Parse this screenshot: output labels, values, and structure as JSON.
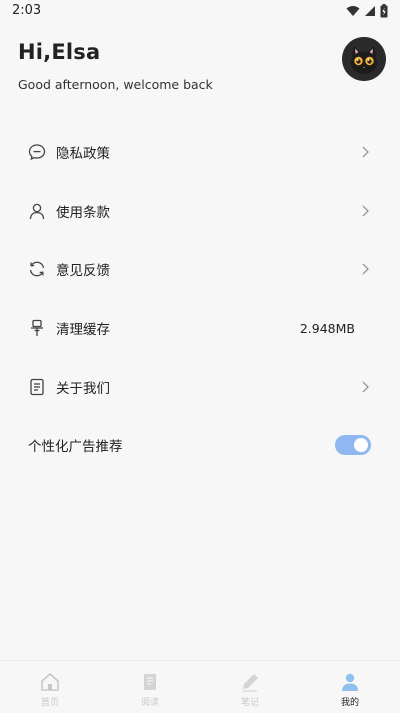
{
  "status_bar": {
    "time": "2:03",
    "icons": [
      "wifi-icon",
      "signal-icon",
      "battery-icon"
    ]
  },
  "header": {
    "greeting": "Hi,Elsa",
    "subgreeting": "Good afternoon, welcome back",
    "avatar": "cat-avatar"
  },
  "menu": {
    "items": [
      {
        "label": "隐私政策",
        "icon": "message-icon"
      },
      {
        "label": "使用条款",
        "icon": "user-icon"
      },
      {
        "label": "意见反馈",
        "icon": "refresh-icon"
      },
      {
        "label": "清理缓存",
        "icon": "broom-icon",
        "value": "2.948MB"
      },
      {
        "label": "关于我们",
        "icon": "document-icon"
      }
    ]
  },
  "ad_setting": {
    "label": "个性化广告推荐",
    "enabled": true
  },
  "tabs": [
    {
      "label": "首页",
      "icon": "home-icon",
      "active": false
    },
    {
      "label": "阅读",
      "icon": "book-icon",
      "active": false
    },
    {
      "label": "笔记",
      "icon": "pen-icon",
      "active": false
    },
    {
      "label": "我的",
      "icon": "profile-icon",
      "active": true
    }
  ],
  "colors": {
    "background": "#f7f7f7",
    "toggle_on": "#8fb8f0",
    "active_tab_icon": "#8fc0ee",
    "inactive_tab": "#c8c8c8"
  }
}
